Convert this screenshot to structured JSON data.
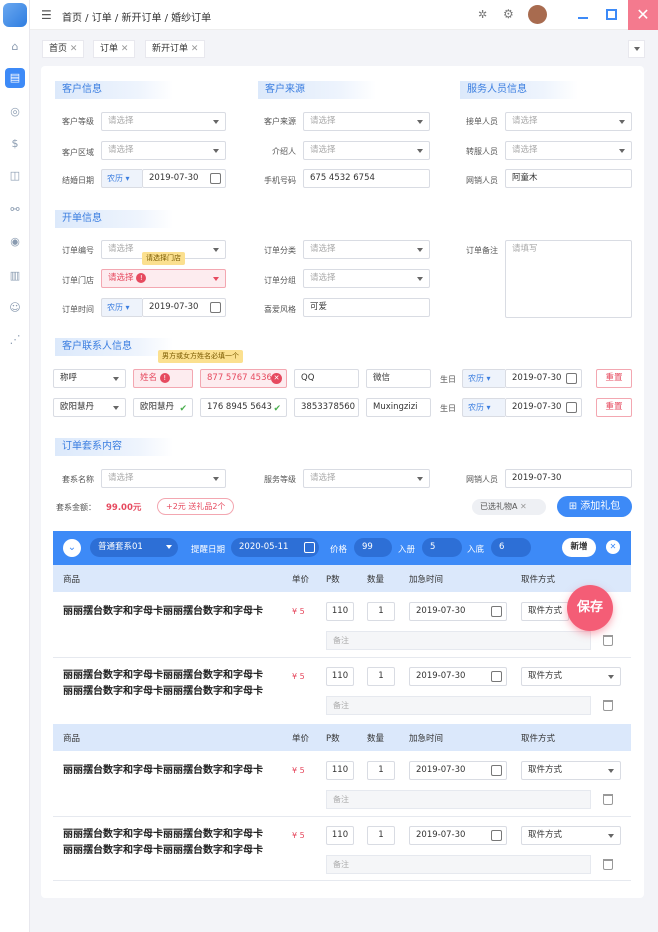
{
  "breadcrumb": "首页 / 订单 / 新开订单 / 婚纱订单",
  "tabs": [
    "首页",
    "订单",
    "新开订单"
  ],
  "colors": {
    "accent": "#3d8af7",
    "danger": "#e64a5f",
    "close": "#f47a8e",
    "save": "#f45d76"
  },
  "sections": {
    "customer_info": "客户信息",
    "customer_source": "客户来源",
    "service_staff": "服务人员信息",
    "order_info": "开单信息",
    "contact": "客户联系人信息",
    "package": "订单套系内容"
  },
  "placeholder": "请选择",
  "placeholder_input": "请填写",
  "lunar": "农历",
  "customer": {
    "level": "客户等级",
    "region": "客户区域",
    "wedding_date": "结婚日期",
    "wedding_date_value": "2019-07-30"
  },
  "source": {
    "source": "客户来源",
    "referrer": "介绍人",
    "phone": "手机号码",
    "phone_value": "675 4532 6754"
  },
  "staff": {
    "receiver": "接单人员",
    "transfer": "转服人员",
    "online": "网销人员",
    "online_value": "阿童木"
  },
  "order": {
    "no": "订单编号",
    "store": "订单门店",
    "store_tip": "请选择门店",
    "time": "订单时间",
    "time_value": "2019-07-30",
    "category": "订单分类",
    "group": "订单分组",
    "style": "喜爱风格",
    "style_value": "可爱",
    "remark": "订单备注"
  },
  "contact": {
    "tip": "男方或女方姓名必填一个",
    "row1": {
      "title": "称呼",
      "name": "姓名",
      "phone": "877 5767 4536",
      "qq": "QQ",
      "wechat": "微信",
      "birthday": "生日",
      "date": "2019-07-30",
      "reset": "重置"
    },
    "row2": {
      "title": "欧阳慧丹",
      "name": "欧阳慧丹",
      "phone": "176 8945 5643",
      "qq": "3853378560",
      "wechat": "Muxingzizi",
      "birthday": "生日",
      "date": "2019-07-30",
      "reset": "重置"
    }
  },
  "package": {
    "name": "套系名称",
    "service_level": "服务等级",
    "online": "网销人员",
    "online_value": "2019-07-30",
    "amount_label": "套系金额：",
    "amount": "99.00元",
    "gift_info": "+2元 送礼品2个",
    "selected_gift": "已选礼物A",
    "add_gift": "添加礼包"
  },
  "pkg_bar": {
    "type": "普通套系01",
    "remind": "提醒日期",
    "remind_date": "2020-05-11",
    "price_label": "价格",
    "price": "99",
    "in_label": "入册",
    "in": "5",
    "base_label": "入底",
    "base": "6",
    "add": "新增"
  },
  "table_headers": {
    "product": "商品",
    "unit": "单价",
    "p": "P数",
    "qty": "数量",
    "urgent": "加急时间",
    "pickup": "取件方式"
  },
  "rows": [
    {
      "name1": "丽丽摆台数字和字母卡丽丽摆台数字和字母卡",
      "name2": "",
      "price": "¥ 5",
      "p": "110",
      "qty": "1",
      "date": "2019-07-30",
      "pickup": "取件方式",
      "note": "备注"
    },
    {
      "name1": "丽丽摆台数字和字母卡丽丽摆台数字和字母卡",
      "name2": "丽丽摆台数字和字母卡丽丽摆台数字和字母卡",
      "price": "¥ 5",
      "p": "110",
      "qty": "1",
      "date": "2019-07-30",
      "pickup": "取件方式",
      "note": "备注"
    },
    {
      "name1": "丽丽摆台数字和字母卡丽丽摆台数字和字母卡",
      "name2": "",
      "price": "¥ 5",
      "p": "110",
      "qty": "1",
      "date": "2019-07-30",
      "pickup": "取件方式",
      "note": "备注"
    },
    {
      "name1": "丽丽摆台数字和字母卡丽丽摆台数字和字母卡",
      "name2": "丽丽摆台数字和字母卡丽丽摆台数字和字母卡",
      "price": "¥ 5",
      "p": "110",
      "qty": "1",
      "date": "2019-07-30",
      "pickup": "取件方式",
      "note": "备注"
    }
  ],
  "save": "保存"
}
